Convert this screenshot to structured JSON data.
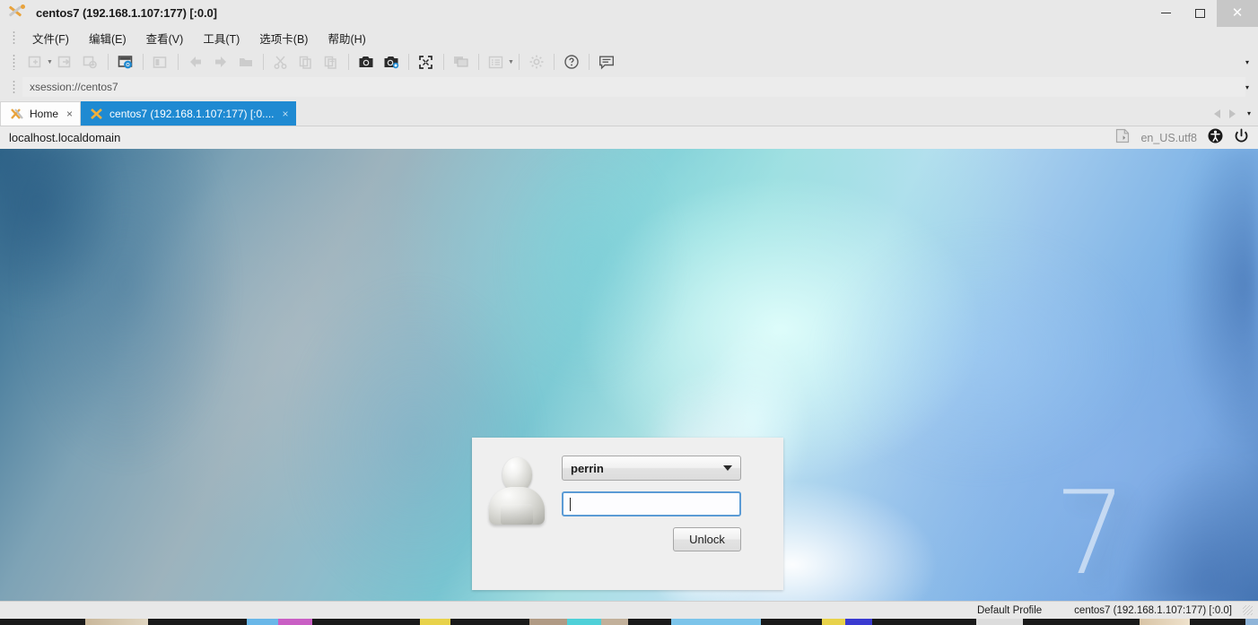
{
  "window": {
    "title": "centos7 (192.168.1.107:177) [:0.0]",
    "app_icon": "mobaxterm-x-icon",
    "minimize_label": "−",
    "maximize_label": "□",
    "close_label": "✕"
  },
  "menubar": {
    "items": [
      {
        "label": "文件(F)",
        "name": "menu-file"
      },
      {
        "label": "编辑(E)",
        "name": "menu-edit"
      },
      {
        "label": "查看(V)",
        "name": "menu-view"
      },
      {
        "label": "工具(T)",
        "name": "menu-tools"
      },
      {
        "label": "选项卡(B)",
        "name": "menu-tabs"
      },
      {
        "label": "帮助(H)",
        "name": "menu-help"
      }
    ]
  },
  "toolbar": {
    "icons": [
      "new-session-icon",
      "open-session-icon",
      "close-session-icon",
      "session-settings-icon",
      "split-view-icon",
      "back-icon",
      "forward-icon",
      "folder-icon",
      "cut-icon",
      "copy-icon",
      "paste-icon",
      "screenshot-icon",
      "screenshot-add-icon",
      "fullscreen-icon",
      "multiexec-icon",
      "list-view-icon",
      "settings-gear-icon",
      "help-icon",
      "comment-icon"
    ],
    "overflow_caret": "▾"
  },
  "address": {
    "value": "xsession://centos7",
    "overflow_caret": "▾"
  },
  "tabs": {
    "items": [
      {
        "label": "Home",
        "icon": "mobaxterm-x-icon",
        "close": "×",
        "active": false
      },
      {
        "label": "centos7 (192.168.1.107:177) [:0....",
        "icon": "x-server-icon",
        "close": "×",
        "active": true
      }
    ],
    "nav_prev": "prev-tab-arrow",
    "nav_next": "next-tab-arrow",
    "nav_caret": "▾"
  },
  "session_bar": {
    "hostname": "localhost.localdomain",
    "keyboard_icon": "keyboard-layout-icon",
    "locale": "en_US.utf8",
    "accessibility_icon": "accessibility-icon",
    "power_icon": "power-icon"
  },
  "desktop": {
    "watermark": "7"
  },
  "unlock_dialog": {
    "avatar_icon": "user-avatar-icon",
    "username": "perrin",
    "dropdown_caret": "▾",
    "password_value": "",
    "password_placeholder": "",
    "unlock_label": "Unlock"
  },
  "statusbar": {
    "profile": "Default Profile",
    "session": "centos7 (192.168.1.107:177) [:0.0]"
  },
  "colors": {
    "active_tab_bg": "#1f8ad2",
    "focus_border": "#5b9bd5",
    "toolbar_accent": "#1f8ad2",
    "chrome_bg": "#e8e8e8"
  }
}
